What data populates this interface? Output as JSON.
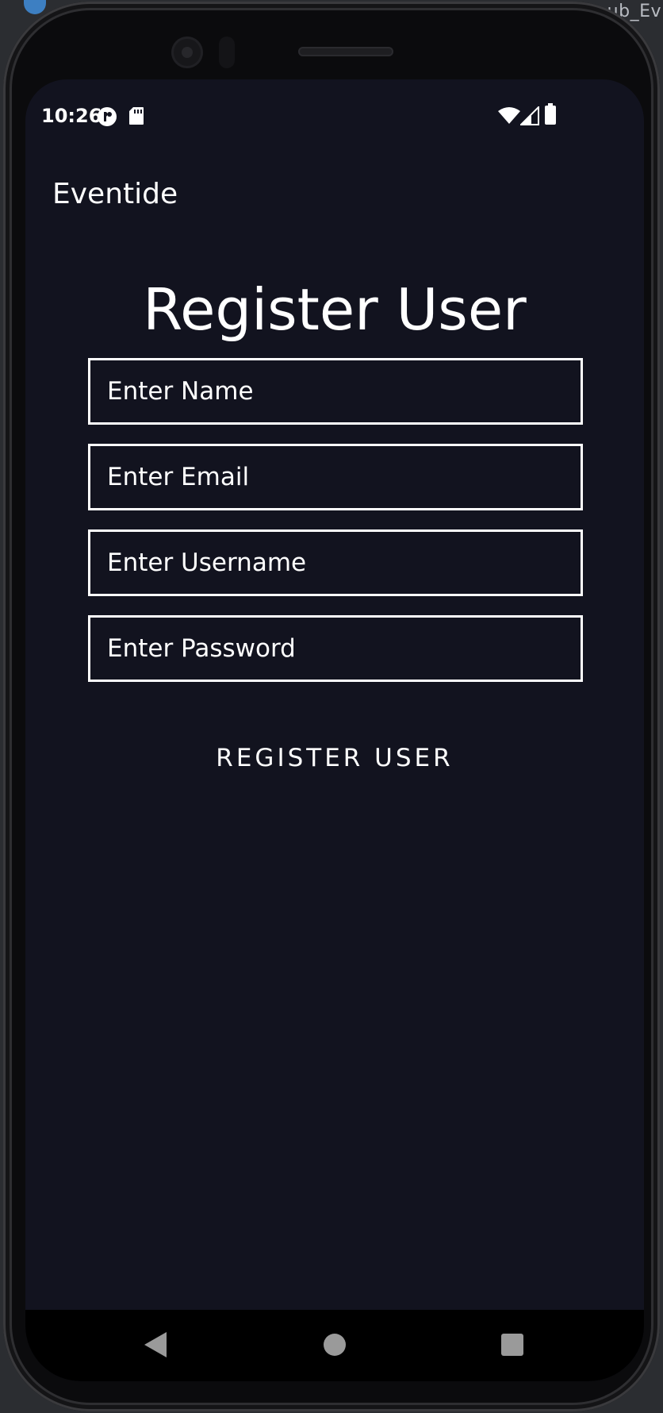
{
  "ide": {
    "tab_fragment": "ub_Ev"
  },
  "status_bar": {
    "time": "10:26",
    "left_icons": [
      "media-icon",
      "sd-card-icon"
    ],
    "right_icons": [
      "wifi-icon",
      "cell-signal-icon",
      "battery-icon"
    ]
  },
  "app": {
    "title": "Eventide"
  },
  "form": {
    "heading": "Register User",
    "fields": [
      {
        "name": "name",
        "placeholder": "Enter Name",
        "value": ""
      },
      {
        "name": "email",
        "placeholder": "Enter Email",
        "value": ""
      },
      {
        "name": "username",
        "placeholder": "Enter Username",
        "value": ""
      },
      {
        "name": "password",
        "placeholder": "Enter Password",
        "value": ""
      }
    ],
    "submit_label": "REGISTER USER"
  },
  "navigation": {
    "buttons": [
      "back-icon",
      "home-icon",
      "recents-icon"
    ]
  },
  "colors": {
    "screen_background": "#12131f",
    "text": "#ffffff",
    "field_border": "#ffffff",
    "nav_background": "#000000",
    "nav_icons": "#9a9a9a"
  }
}
